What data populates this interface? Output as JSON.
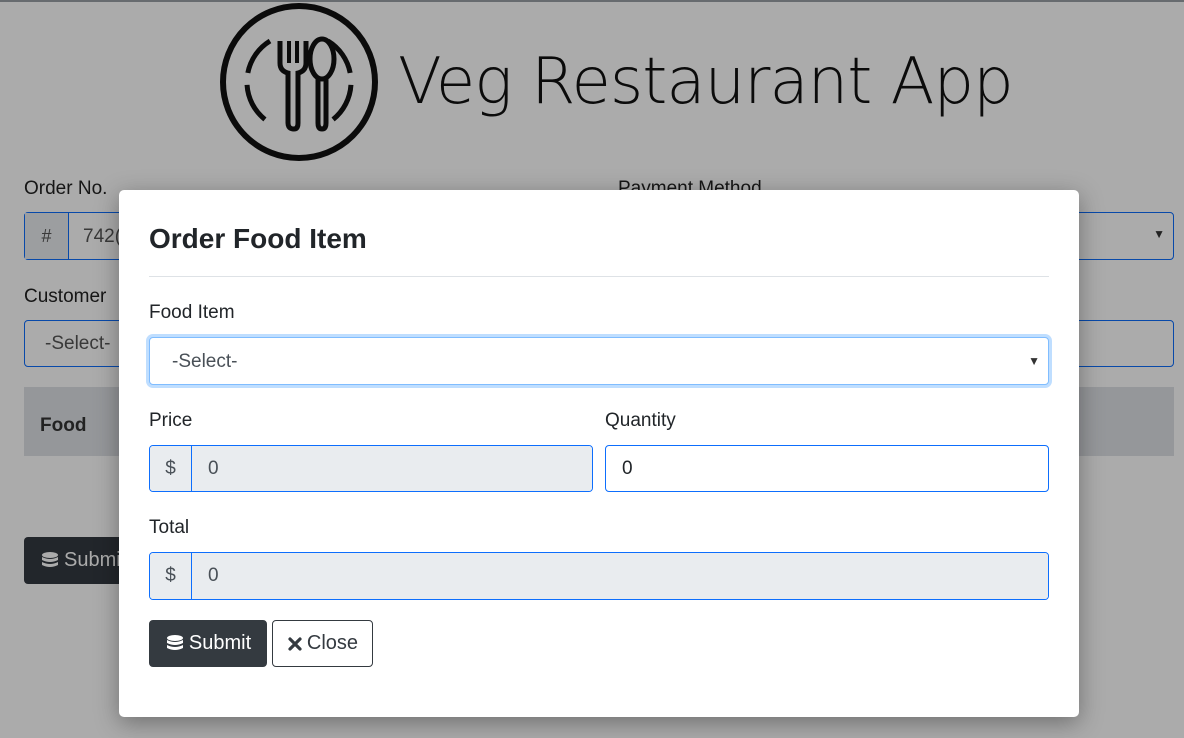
{
  "app": {
    "title": "Veg Restaurant App"
  },
  "background_form": {
    "order_no_label": "Order No.",
    "order_no_prefix": "#",
    "order_no_value": "742(",
    "payment_method_label": "Payment Method",
    "customer_label": "Customer",
    "customer_select": "-Select-",
    "table_header_food": "Food",
    "submit_label": "Submi"
  },
  "modal": {
    "title": "Order Food Item",
    "food_item_label": "Food Item",
    "food_item_selected": "-Select-",
    "price_label": "Price",
    "price_prefix": "$",
    "price_value": "0",
    "quantity_label": "Quantity",
    "quantity_value": "0",
    "total_label": "Total",
    "total_prefix": "$",
    "total_value": "0",
    "submit_label": "Submit",
    "close_label": "Close"
  },
  "icons": {
    "logo": "fork-spoon-plate-icon",
    "submit": "database-icon",
    "close": "close-icon",
    "select_caret": "caret-down-icon"
  },
  "colors": {
    "primary_border": "#0d6efd",
    "dark_button": "#343a40",
    "readonly_bg": "#e9ecef"
  }
}
